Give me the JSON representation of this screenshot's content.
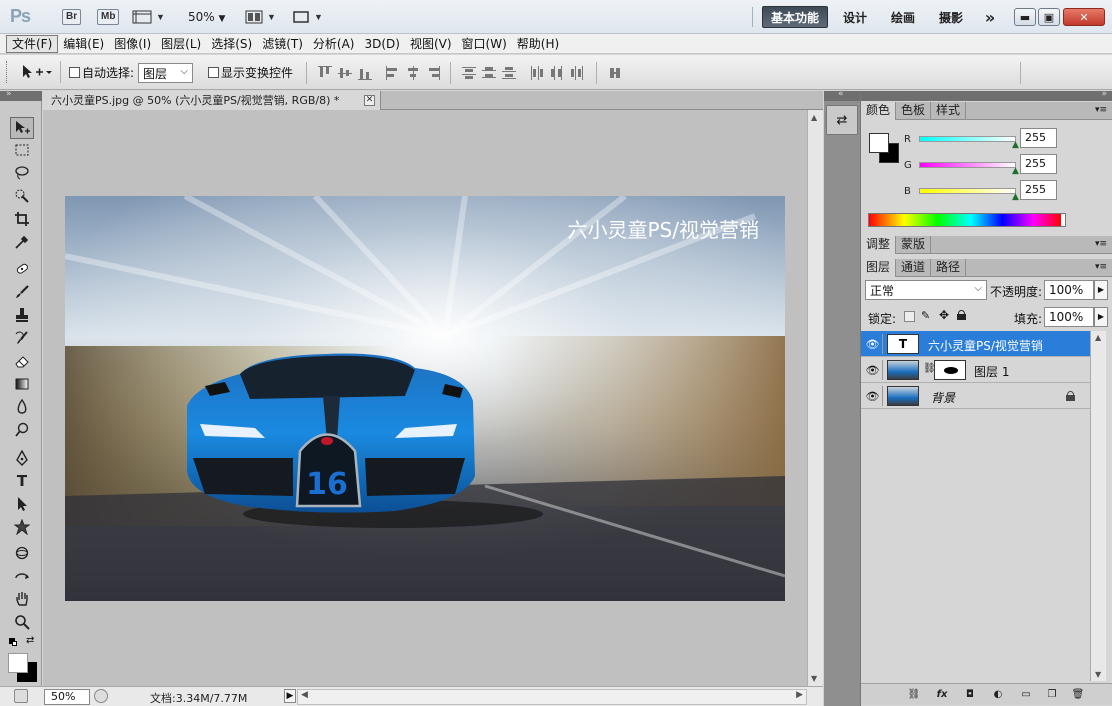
{
  "appbar": {
    "logo": "Ps",
    "bridge": "Br",
    "minibridge": "Mb",
    "zoom": "50%",
    "workspaces": [
      "基本功能",
      "设计",
      "绘画",
      "摄影"
    ],
    "more": "»"
  },
  "menu": [
    "文件(F)",
    "编辑(E)",
    "图像(I)",
    "图层(L)",
    "选择(S)",
    "滤镜(T)",
    "分析(A)",
    "3D(D)",
    "视图(V)",
    "窗口(W)",
    "帮助(H)"
  ],
  "options": {
    "auto_select_label": "自动选择:",
    "auto_select_value": "图层",
    "show_transform_label": "显示变换控件"
  },
  "document": {
    "tab_title": "六小灵童PS.jpg @ 50% (六小灵童PS/视觉营销, RGB/8) *",
    "watermark": "六小灵童PS/视觉营销"
  },
  "status": {
    "zoom": "50%",
    "doc_info": "文档:3.34M/7.77M"
  },
  "color_panel": {
    "tabs": [
      "颜色",
      "色板",
      "样式"
    ],
    "r_label": "R",
    "g_label": "G",
    "b_label": "B",
    "r": "255",
    "g": "255",
    "b": "255"
  },
  "adjust_panel": {
    "tabs": [
      "调整",
      "蒙版"
    ]
  },
  "layers_panel": {
    "tabs": [
      "图层",
      "通道",
      "路径"
    ],
    "blend_mode": "正常",
    "opacity_label": "不透明度:",
    "opacity": "100%",
    "lock_label": "锁定:",
    "fill_label": "填充:",
    "fill": "100%",
    "layers": [
      {
        "name": "六小灵童PS/视觉营销",
        "kind": "text"
      },
      {
        "name": "图层 1",
        "kind": "masked"
      },
      {
        "name": "背景",
        "kind": "background"
      }
    ]
  }
}
